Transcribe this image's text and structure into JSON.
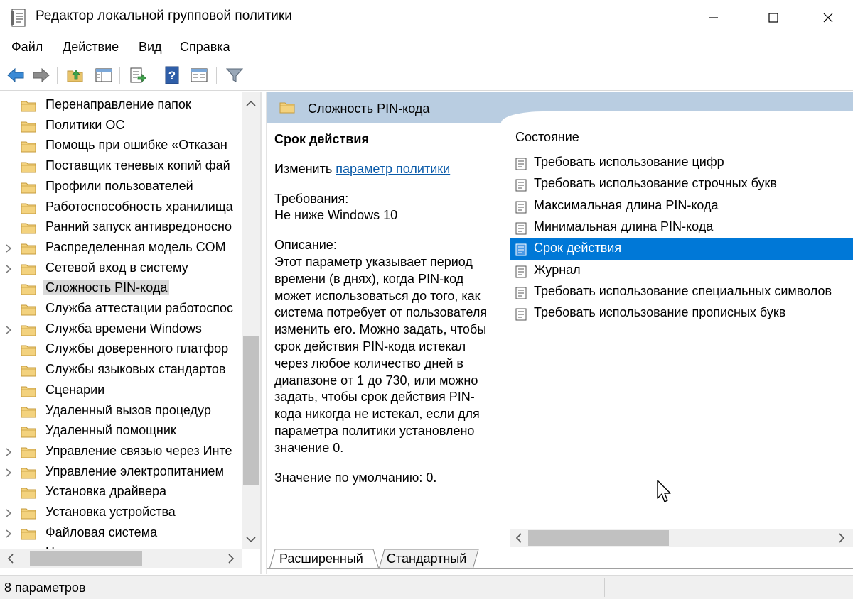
{
  "window": {
    "title": "Редактор локальной групповой политики"
  },
  "menu": [
    "Файл",
    "Действие",
    "Вид",
    "Справка"
  ],
  "tree": {
    "items": [
      {
        "label": "Перенаправление папок",
        "expandable": false
      },
      {
        "label": "Политики ОС",
        "expandable": false
      },
      {
        "label": "Помощь при ошибке «Отказан",
        "expandable": false
      },
      {
        "label": "Поставщик теневых копий фай",
        "expandable": false
      },
      {
        "label": "Профили пользователей",
        "expandable": false
      },
      {
        "label": "Работоспособность хранилища",
        "expandable": false
      },
      {
        "label": "Ранний запуск антивредоносно",
        "expandable": false
      },
      {
        "label": "Распределенная модель COM",
        "expandable": true
      },
      {
        "label": "Сетевой вход в систему",
        "expandable": true
      },
      {
        "label": "Сложность PIN-кода",
        "expandable": false,
        "selected": true
      },
      {
        "label": "Служба аттестации работоспос",
        "expandable": false
      },
      {
        "label": "Служба времени Windows",
        "expandable": true
      },
      {
        "label": "Службы доверенного платфор",
        "expandable": false
      },
      {
        "label": "Службы языковых стандартов",
        "expandable": false
      },
      {
        "label": "Сценарии",
        "expandable": false
      },
      {
        "label": "Удаленный вызов процедур",
        "expandable": false
      },
      {
        "label": "Удаленный помощник",
        "expandable": false
      },
      {
        "label": "Управление связью через Инте",
        "expandable": true
      },
      {
        "label": "Управление электропитанием",
        "expandable": true
      },
      {
        "label": "Установка драйвера",
        "expandable": false
      },
      {
        "label": "Установка устройства",
        "expandable": true
      },
      {
        "label": "Файловая система",
        "expandable": true
      },
      {
        "label": "Ц",
        "expandable": true
      }
    ]
  },
  "details": {
    "header_title": "Сложность PIN-кода",
    "policy_title": "Срок действия",
    "edit_prefix": "Изменить",
    "edit_link": "параметр политики",
    "requirements_label": "Требования:",
    "requirements_value": "Не ниже Windows 10",
    "description_label": "Описание:",
    "description_text": "Этот параметр указывает период времени (в днях), когда PIN-код может использоваться до того, как система потребует от пользователя изменить его. Можно задать, чтобы срок действия PIN-кода истекал через любое количество дней в диапазоне от 1 до 730, или можно задать, чтобы срок действия PIN-кода никогда не истекал, если для параметра политики установлено значение 0.",
    "default_value": "Значение по умолчанию: 0."
  },
  "list": {
    "column_header": "Состояние",
    "items": [
      {
        "label": "Требовать использование цифр"
      },
      {
        "label": "Требовать использование строчных букв"
      },
      {
        "label": "Максимальная длина PIN-кода"
      },
      {
        "label": "Минимальная длина PIN-кода"
      },
      {
        "label": "Срок действия",
        "selected": true
      },
      {
        "label": "Журнал"
      },
      {
        "label": "Требовать использование специальных символов"
      },
      {
        "label": "Требовать использование прописных букв"
      }
    ]
  },
  "tabs": [
    "Расширенный",
    "Стандартный"
  ],
  "status": {
    "text": "8 параметров"
  },
  "colors": {
    "selection": "#0078d7",
    "header_band": "#b9cde1",
    "link": "#0a5aa8",
    "folder": "#e8c36a"
  }
}
